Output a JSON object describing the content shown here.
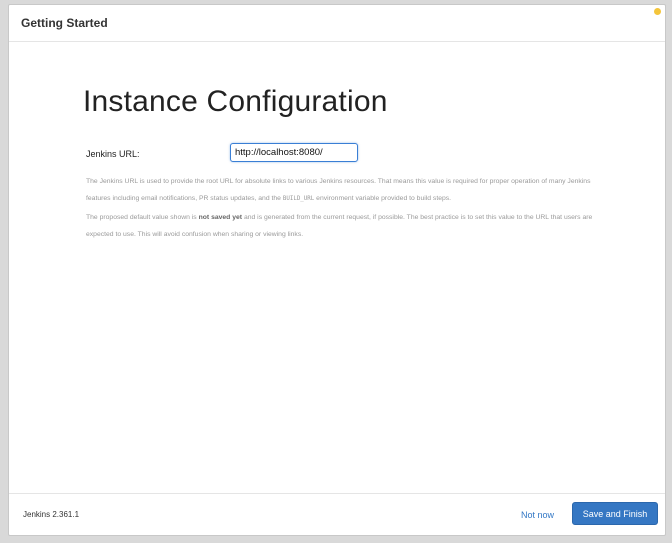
{
  "header": {
    "title": "Getting Started"
  },
  "main": {
    "title": "Instance Configuration",
    "url_label": "Jenkins URL:",
    "url_value": "http://localhost:8080/",
    "help_line1": "The Jenkins URL is used to provide the root URL for absolute links to various Jenkins resources. That means this value is required for proper operation of many Jenkins features including email notifications, PR status updates, and the ",
    "help_code": "BUILD_URL",
    "help_line1_end": " environment variable provided to build steps.",
    "help_p2_start": "The proposed default value shown is ",
    "help_p2_bold": "not saved yet",
    "help_p2_end": " and is generated from the current request, if possible. The best practice is to set this value to the URL that users are expected to use. This will avoid confusion when sharing or viewing links."
  },
  "footer": {
    "version": "Jenkins 2.361.1",
    "not_now_label": "Not now",
    "save_label": "Save and Finish"
  },
  "colors": {
    "accent": "#3577c3",
    "status_dot": "#f4c53b"
  }
}
